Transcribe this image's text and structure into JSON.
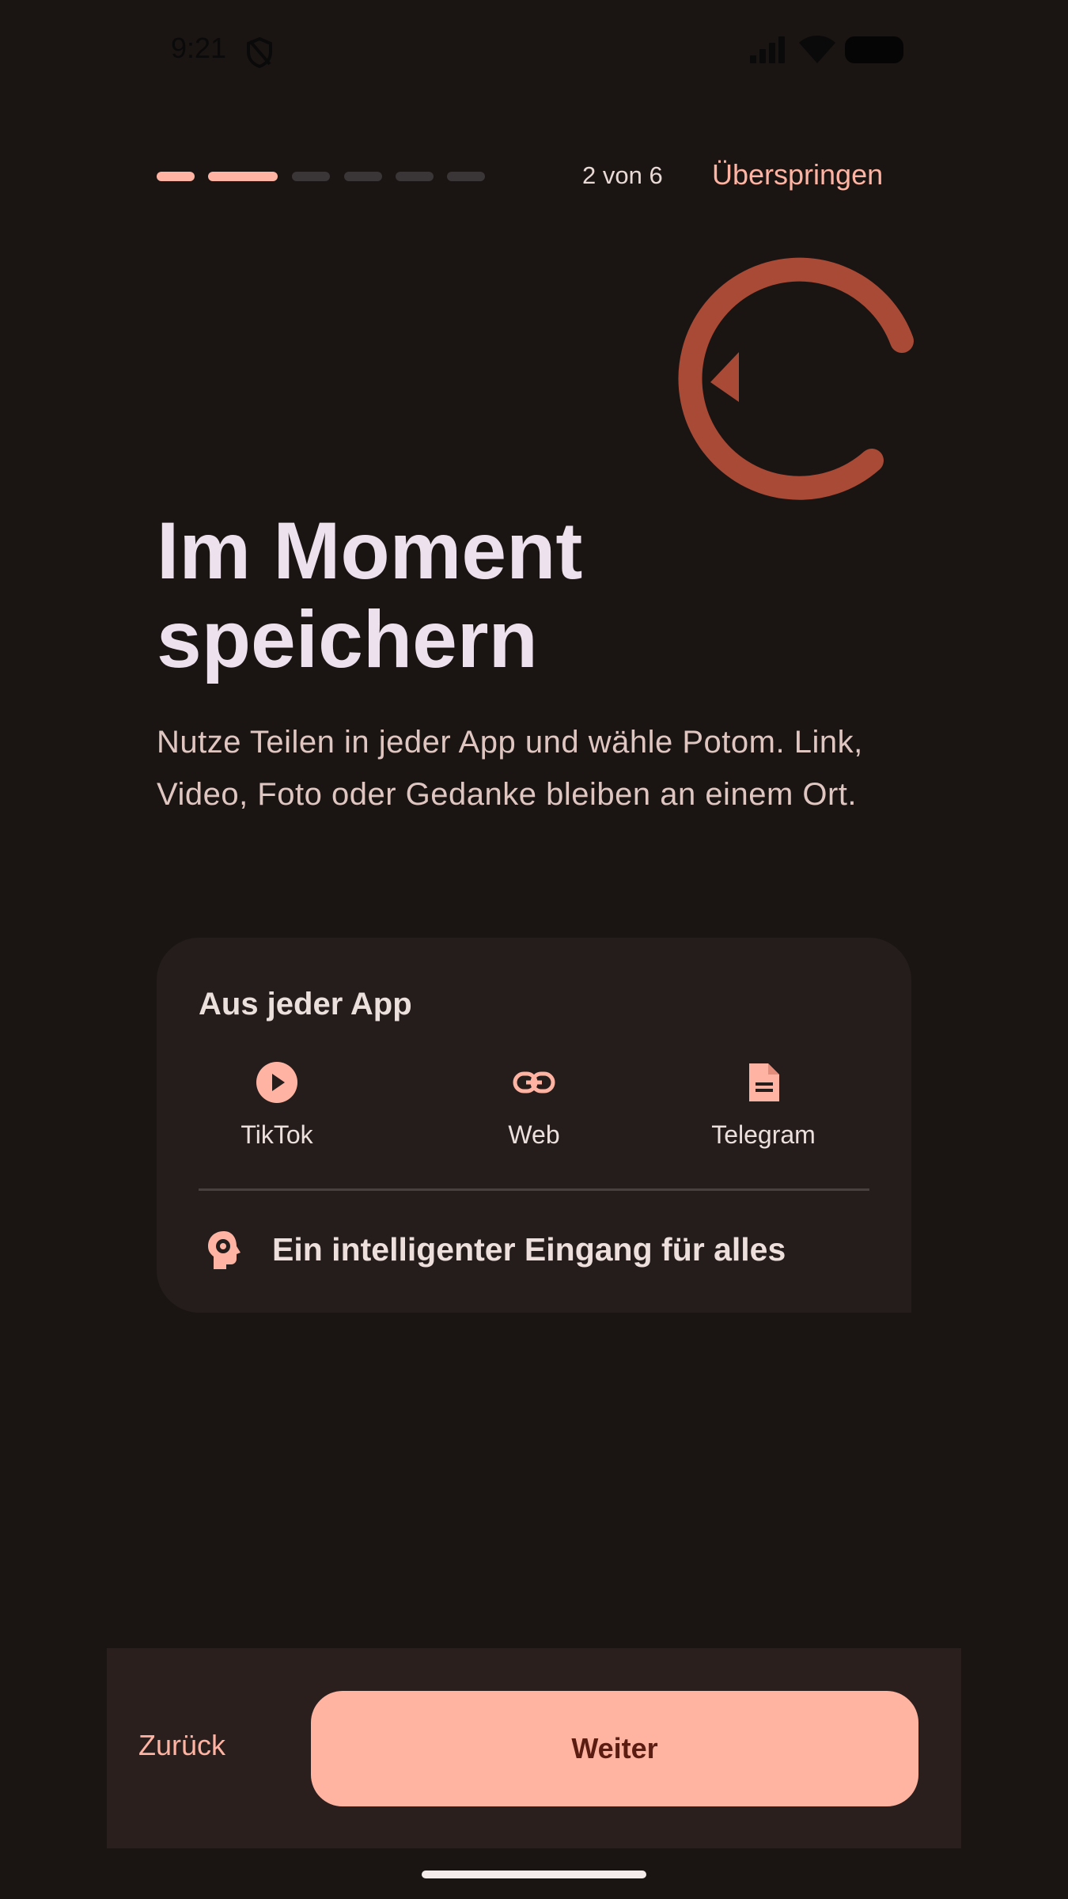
{
  "status_bar": {
    "time": "9:21",
    "icons": [
      "shield-icon",
      "signal-icon",
      "wifi-icon",
      "battery-icon"
    ]
  },
  "progress": {
    "current_step": 2,
    "total_steps": 6,
    "counter_text": "2 von 6",
    "active_color": "#ffb4a3",
    "inactive_color": "#3a3638"
  },
  "header": {
    "skip_label": "Überspringen"
  },
  "hero": {
    "icon": "refresh-arrow-icon",
    "title_line1": "Im Moment",
    "title_line2": "speichern",
    "subtitle": "Nutze Teilen in jeder App und wähle Potom. Link, Video, Foto oder Gedanke bleiben an einem Ort."
  },
  "card": {
    "title": "Aus jeder App",
    "sources": [
      {
        "label": "TikTok",
        "icon": "play-circle-icon"
      },
      {
        "label": "Web",
        "icon": "link-icon"
      },
      {
        "label": "Telegram",
        "icon": "document-icon"
      }
    ],
    "smart_inbox": {
      "icon": "brain-gear-icon",
      "label": "Ein intelligenter Eingang für alles"
    }
  },
  "footer": {
    "back_label": "Zurück",
    "next_label": "Weiter"
  },
  "colors": {
    "background": "#1a1513",
    "accent": "#ffb4a3",
    "deco_icon": "#a84a36",
    "card_bg": "#251d1b",
    "bottom_bar_bg": "#2b1f1e"
  }
}
